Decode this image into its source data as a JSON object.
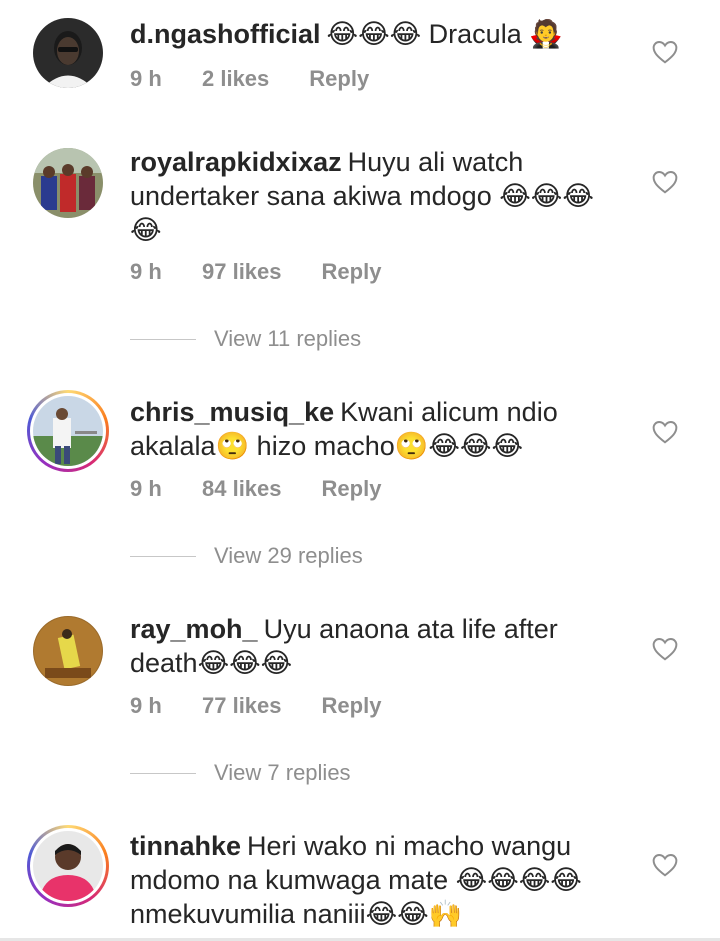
{
  "comments": [
    {
      "username": "d.ngashofficial",
      "text_a": "😂😂😂 Dracula 🧛",
      "line2": "",
      "line3": "",
      "time": "9 h",
      "likes": "2 likes",
      "reply": "Reply",
      "view_replies": ""
    },
    {
      "username": "royalrapkidxixaz",
      "text_a": "Huyu ali watch",
      "line2": "undertaker sana akiwa mdogo 😂😂😂",
      "line3": "😂",
      "time": "9 h",
      "likes": "97 likes",
      "reply": "Reply",
      "view_replies": "View 11 replies"
    },
    {
      "username": "chris_musiq_ke",
      "text_a": "Kwani alicum ndio",
      "line2": "akalala🙄 hizo macho🙄😂😂😂",
      "line3": "",
      "time": "9 h",
      "likes": "84 likes",
      "reply": "Reply",
      "view_replies": "View 29 replies"
    },
    {
      "username": "ray_moh_",
      "text_a": "Uyu anaona ata life after",
      "line2": "death😂😂😂",
      "line3": "",
      "time": "9 h",
      "likes": "77 likes",
      "reply": "Reply",
      "view_replies": "View 7 replies"
    },
    {
      "username": "tinnahke",
      "text_a": "Heri wako ni macho wangu",
      "line2": "mdomo na kumwaga mate 😂😂😂😂",
      "line3": "nmekuvumilia naniii😂😂🙌",
      "time": "",
      "likes": "",
      "reply": "",
      "view_replies": ""
    }
  ],
  "colors": {
    "text": "#262626",
    "meta": "#8e8e8e",
    "divider": "#c7c7c7"
  },
  "icons": {
    "like": "heart-outline-icon",
    "avatar_ring": "story-ring"
  }
}
